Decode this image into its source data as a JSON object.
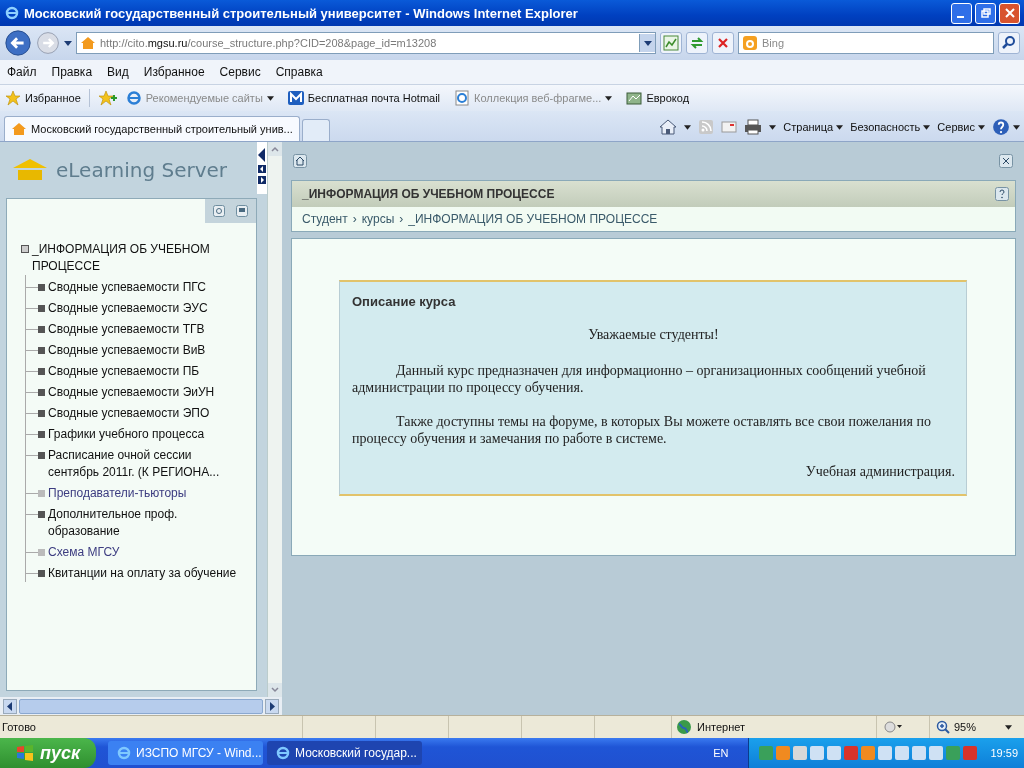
{
  "window": {
    "title": "Московский государственный строительный университет - Windows Internet Explorer"
  },
  "address_bar": {
    "url_prefix": "http://cito.",
    "url_domain": "mgsu.ru",
    "url_path": "/course_structure.php?CID=208&page_id=m13208"
  },
  "search": {
    "placeholder": "Bing"
  },
  "menu": [
    "Файл",
    "Правка",
    "Вид",
    "Избранное",
    "Сервис",
    "Справка"
  ],
  "favorites_bar": {
    "favorites": "Избранное",
    "links": [
      {
        "label": "Рекомендуемые сайты",
        "kind": "ie",
        "dropdown": true,
        "dimmed": true
      },
      {
        "label": "Бесплатная почта Hotmail",
        "kind": "mail",
        "dropdown": false,
        "dimmed": false
      },
      {
        "label": "Коллекция веб-фрагме...",
        "kind": "page",
        "dropdown": true,
        "dimmed": true
      },
      {
        "label": "Еврокод",
        "kind": "map",
        "dropdown": false,
        "dimmed": false
      }
    ]
  },
  "tabs": [
    {
      "label": "Московский государственный строительный унив...",
      "selected": true
    }
  ],
  "command_bar": [
    "Страница",
    "Безопасность",
    "Сервис"
  ],
  "app": {
    "logo": "eLearning Server",
    "tree": {
      "label": "_ИНФОРМАЦИЯ ОБ УЧЕБНОМ ПРОЦЕССЕ",
      "children": [
        {
          "label": "Сводные успеваемости ПГС",
          "visited": false
        },
        {
          "label": "Сводные успеваемости ЭУС",
          "visited": false
        },
        {
          "label": "Сводные успеваемости ТГВ",
          "visited": false
        },
        {
          "label": "Сводные успеваемости ВиВ",
          "visited": false
        },
        {
          "label": "Сводные успеваемости ПБ",
          "visited": false
        },
        {
          "label": "Сводные успеваемости ЭиУН",
          "visited": false
        },
        {
          "label": "Сводные успеваемости ЭПО",
          "visited": false
        },
        {
          "label": "Графики учебного процесса",
          "visited": false
        },
        {
          "label": "Расписание очной сессии сентябрь 2011г. (К РЕГИОНА...",
          "visited": false
        },
        {
          "label": "Преподаватели-тьюторы",
          "visited": true
        },
        {
          "label": "Дополнительное проф. образование",
          "visited": false
        },
        {
          "label": "Схема МГСУ",
          "visited": true
        },
        {
          "label": "Квитанции на оплату за обучение",
          "visited": false
        }
      ]
    }
  },
  "page": {
    "title": "_ИНФОРМАЦИЯ ОБ УЧЕБНОМ ПРОЦЕССЕ",
    "breadcrumbs": [
      "Студент",
      "курсы",
      "_ИНФОРМАЦИЯ ОБ УЧЕБНОМ ПРОЦЕССЕ"
    ],
    "separator": "›"
  },
  "card": {
    "title": "Описание курса",
    "greeting": "Уважаемые студенты!",
    "paragraphs": [
      "Данный курс предназначен для информационно – организационных сообщений учебной администрации по процессу обучения.",
      "Также доступны темы на форуме, в которых Вы можете оставлять все свои пожелания по процессу обучения и замечания по работе в системе."
    ],
    "signature": "Учебная администрация."
  },
  "status_bar": {
    "text": "Готово",
    "zone": "Интернет",
    "zoom": "95%"
  },
  "taskbar": {
    "start": "пуск",
    "windows": [
      {
        "label": "ИЗСПО МГСУ - Wind...",
        "selected": false
      },
      {
        "label": "Московский государ...",
        "selected": true
      }
    ],
    "language": "EN",
    "clock": "19:59"
  }
}
